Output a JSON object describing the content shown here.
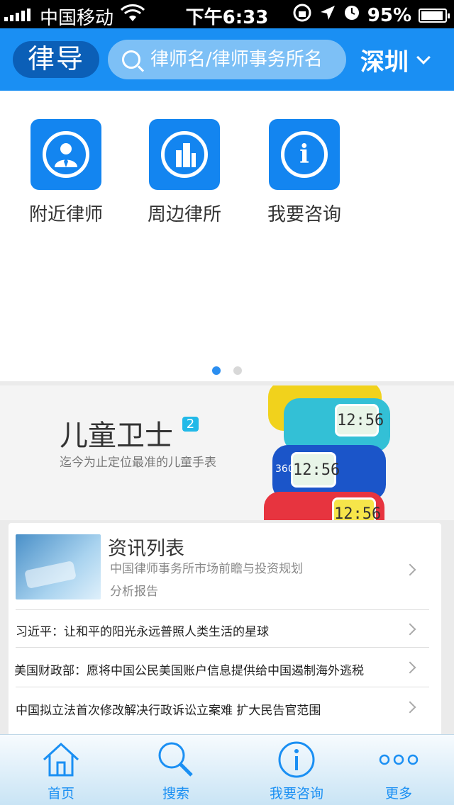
{
  "status_bar": {
    "carrier": "中国移动",
    "time": "下午6:33",
    "battery_percent": "95%",
    "battery_level": 0.95
  },
  "nav": {
    "logo_text": "律导",
    "search_placeholder": "律师名/律师事务所名",
    "city": "深圳"
  },
  "quick_actions": [
    {
      "label": "附近律师",
      "icon": "lawyer-icon"
    },
    {
      "label": "周边律所",
      "icon": "building-icon"
    },
    {
      "label": "我要咨询",
      "icon": "info-icon"
    }
  ],
  "pager": {
    "pages": 2,
    "active": 0
  },
  "banner": {
    "title": "儿童卫士",
    "badge": "2",
    "subtitle": "迄今为止定位最准的儿童手表",
    "watch_time": "12:56",
    "watch_brand": "360"
  },
  "news": {
    "featured": {
      "title": "资讯列表",
      "line1": "中国律师事务所市场前瞻与投资规划",
      "line2": "分析报告"
    },
    "items": [
      "习近平：让和平的阳光永远普照人类生活的星球",
      "美国财政部：愿将中国公民美国账户信息提供给中国遏制海外逃税",
      "中国拟立法首次修改解决行政诉讼立案难  扩大民告官范围"
    ]
  },
  "tabbar": [
    {
      "label": "首页",
      "icon": "home-icon"
    },
    {
      "label": "搜索",
      "icon": "search-icon"
    },
    {
      "label": "我要咨询",
      "icon": "info-icon"
    },
    {
      "label": "更多",
      "icon": "more-icon"
    }
  ],
  "colors": {
    "brand": "#1a8ff3",
    "tile": "#1385f0"
  }
}
